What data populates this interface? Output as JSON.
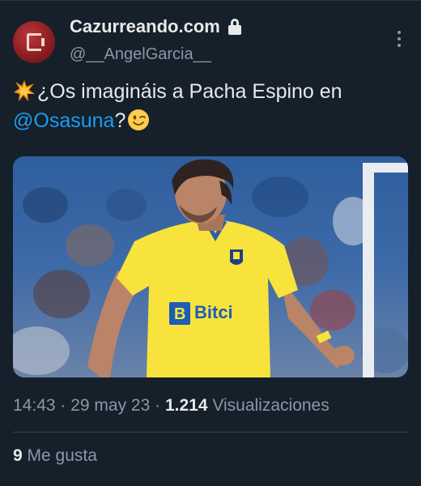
{
  "tweet": {
    "display_name": "Cazurreando.com",
    "handle": "@__AngelGarcia__",
    "text_before_mention": "¿Os imagináis a Pacha Espino en ",
    "mention": "@Osasuna",
    "text_after_mention": "?",
    "emoji_lead": "collision-icon",
    "emoji_trail": "winking-face-icon",
    "image_alt": "Footballer in yellow jersey",
    "image_visible_text": "Bitci"
  },
  "meta": {
    "time": "14:43",
    "sep1": " · ",
    "date": "29 may 23",
    "sep2": " · ",
    "views_count": "1.214",
    "views_label": " Visualizaciones"
  },
  "likes": {
    "count": "9",
    "label": " Me gusta"
  },
  "colors": {
    "background": "#15202b",
    "link": "#1d9bf0",
    "secondary_text": "#8b98a5",
    "jersey": "#f7e33b"
  }
}
